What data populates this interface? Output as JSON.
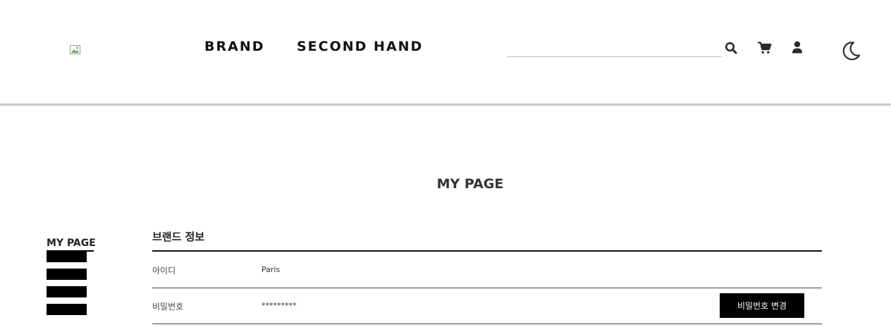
{
  "header": {
    "logo_icon": "broken-image-icon",
    "nav": {
      "brand": "BRAND",
      "second_hand": "SECOND HAND"
    },
    "search": {
      "value": "",
      "placeholder": ""
    },
    "icons": [
      "search-icon",
      "cart-icon",
      "user-icon",
      "moon-icon"
    ]
  },
  "main": {
    "title": "MY PAGE"
  },
  "sidebar": {
    "title": "MY PAGE",
    "items": [
      "",
      "",
      "",
      ""
    ]
  },
  "brand_info": {
    "title": "브랜드 정보",
    "rows": [
      {
        "label": "아이디",
        "value": "Paris"
      },
      {
        "label": "비밀번호",
        "value": "*********"
      }
    ],
    "change_password_label": "비밀번호 변경"
  },
  "colors": {
    "text": "#222222",
    "button_bg": "#000000",
    "button_text": "#ffffff",
    "rule": "#111111"
  }
}
